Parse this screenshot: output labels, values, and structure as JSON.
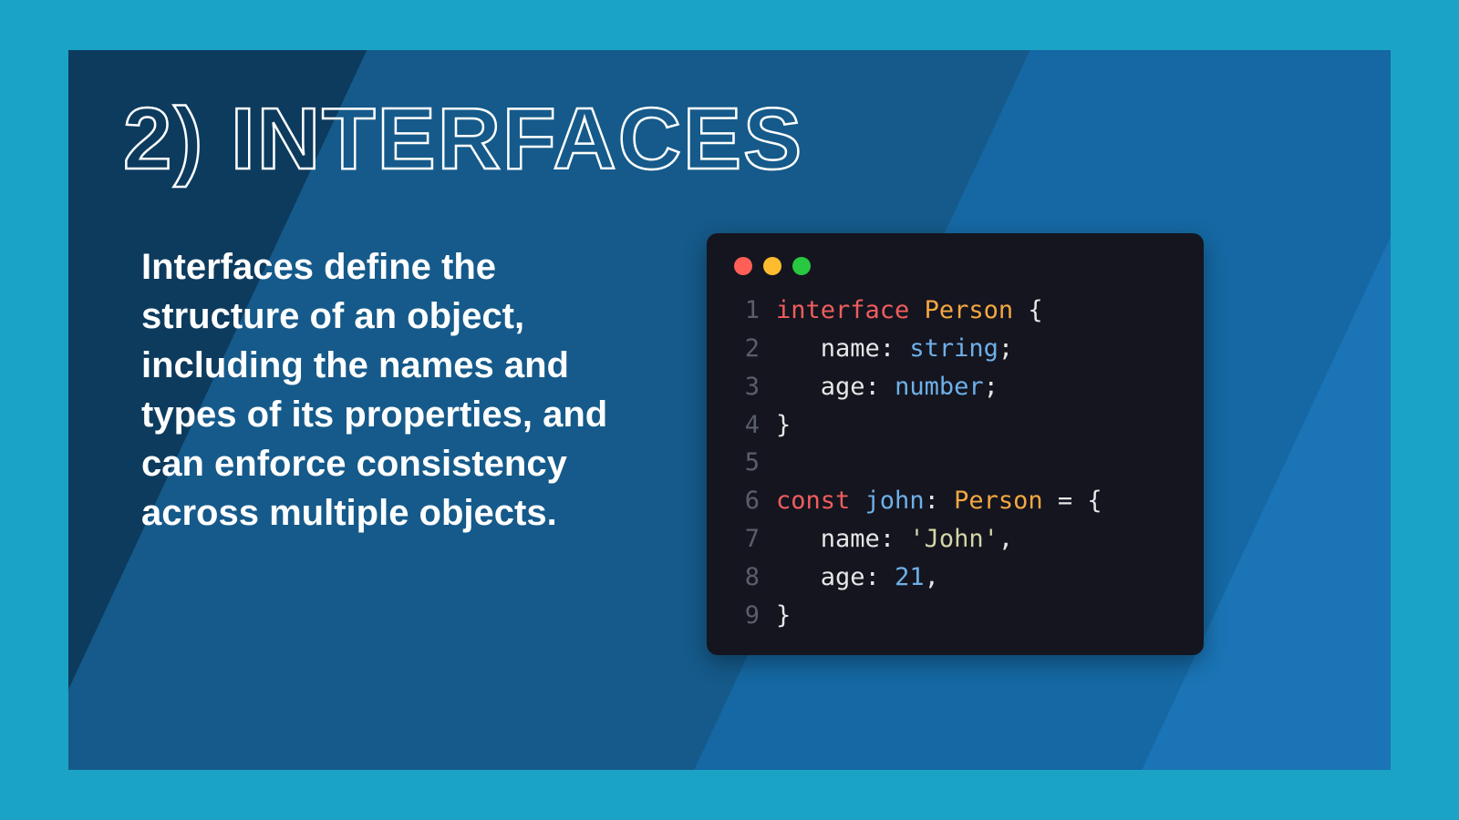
{
  "title": "2) INTERFACES",
  "description": "Interfaces define the structure of an object, including the names and types of its properties, and can enforce consistency across multiple objects.",
  "code": {
    "lines": [
      {
        "num": "1",
        "segments": [
          {
            "cls": "kw",
            "t": "interface"
          },
          {
            "cls": "pl",
            "t": " "
          },
          {
            "cls": "type",
            "t": "Person"
          },
          {
            "cls": "pl",
            "t": " {"
          }
        ]
      },
      {
        "num": "2",
        "segments": [
          {
            "cls": "pl",
            "t": "   "
          },
          {
            "cls": "prop",
            "t": "name"
          },
          {
            "cls": "pl",
            "t": ": "
          },
          {
            "cls": "prim",
            "t": "string"
          },
          {
            "cls": "pl",
            "t": ";"
          }
        ]
      },
      {
        "num": "3",
        "segments": [
          {
            "cls": "pl",
            "t": "   "
          },
          {
            "cls": "prop",
            "t": "age"
          },
          {
            "cls": "pl",
            "t": ": "
          },
          {
            "cls": "prim",
            "t": "number"
          },
          {
            "cls": "pl",
            "t": ";"
          }
        ]
      },
      {
        "num": "4",
        "segments": [
          {
            "cls": "pl",
            "t": "}"
          }
        ]
      },
      {
        "num": "5",
        "segments": [
          {
            "cls": "pl",
            "t": ""
          }
        ]
      },
      {
        "num": "6",
        "segments": [
          {
            "cls": "kw",
            "t": "const"
          },
          {
            "cls": "pl",
            "t": " "
          },
          {
            "cls": "id",
            "t": "john"
          },
          {
            "cls": "pl",
            "t": ": "
          },
          {
            "cls": "type",
            "t": "Person"
          },
          {
            "cls": "pl",
            "t": " = {"
          }
        ]
      },
      {
        "num": "7",
        "segments": [
          {
            "cls": "pl",
            "t": "   "
          },
          {
            "cls": "prop",
            "t": "name"
          },
          {
            "cls": "pl",
            "t": ": "
          },
          {
            "cls": "str",
            "t": "'John'"
          },
          {
            "cls": "pl",
            "t": ","
          }
        ]
      },
      {
        "num": "8",
        "segments": [
          {
            "cls": "pl",
            "t": "   "
          },
          {
            "cls": "prop",
            "t": "age"
          },
          {
            "cls": "pl",
            "t": ": "
          },
          {
            "cls": "num",
            "t": "21"
          },
          {
            "cls": "pl",
            "t": ","
          }
        ]
      },
      {
        "num": "9",
        "segments": [
          {
            "cls": "pl",
            "t": "}"
          }
        ]
      }
    ]
  }
}
